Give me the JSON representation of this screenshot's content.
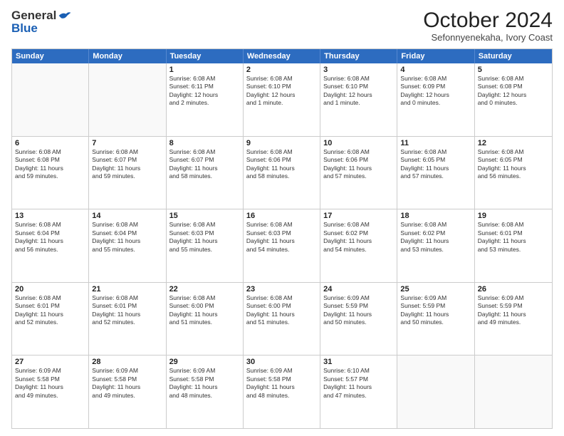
{
  "logo": {
    "general": "General",
    "blue": "Blue"
  },
  "title": "October 2024",
  "location": "Sefonnyenekaha, Ivory Coast",
  "header": {
    "days": [
      "Sunday",
      "Monday",
      "Tuesday",
      "Wednesday",
      "Thursday",
      "Friday",
      "Saturday"
    ]
  },
  "weeks": [
    [
      {
        "day": "",
        "info": ""
      },
      {
        "day": "",
        "info": ""
      },
      {
        "day": "1",
        "info": "Sunrise: 6:08 AM\nSunset: 6:11 PM\nDaylight: 12 hours\nand 2 minutes."
      },
      {
        "day": "2",
        "info": "Sunrise: 6:08 AM\nSunset: 6:10 PM\nDaylight: 12 hours\nand 1 minute."
      },
      {
        "day": "3",
        "info": "Sunrise: 6:08 AM\nSunset: 6:10 PM\nDaylight: 12 hours\nand 1 minute."
      },
      {
        "day": "4",
        "info": "Sunrise: 6:08 AM\nSunset: 6:09 PM\nDaylight: 12 hours\nand 0 minutes."
      },
      {
        "day": "5",
        "info": "Sunrise: 6:08 AM\nSunset: 6:08 PM\nDaylight: 12 hours\nand 0 minutes."
      }
    ],
    [
      {
        "day": "6",
        "info": "Sunrise: 6:08 AM\nSunset: 6:08 PM\nDaylight: 11 hours\nand 59 minutes."
      },
      {
        "day": "7",
        "info": "Sunrise: 6:08 AM\nSunset: 6:07 PM\nDaylight: 11 hours\nand 59 minutes."
      },
      {
        "day": "8",
        "info": "Sunrise: 6:08 AM\nSunset: 6:07 PM\nDaylight: 11 hours\nand 58 minutes."
      },
      {
        "day": "9",
        "info": "Sunrise: 6:08 AM\nSunset: 6:06 PM\nDaylight: 11 hours\nand 58 minutes."
      },
      {
        "day": "10",
        "info": "Sunrise: 6:08 AM\nSunset: 6:06 PM\nDaylight: 11 hours\nand 57 minutes."
      },
      {
        "day": "11",
        "info": "Sunrise: 6:08 AM\nSunset: 6:05 PM\nDaylight: 11 hours\nand 57 minutes."
      },
      {
        "day": "12",
        "info": "Sunrise: 6:08 AM\nSunset: 6:05 PM\nDaylight: 11 hours\nand 56 minutes."
      }
    ],
    [
      {
        "day": "13",
        "info": "Sunrise: 6:08 AM\nSunset: 6:04 PM\nDaylight: 11 hours\nand 56 minutes."
      },
      {
        "day": "14",
        "info": "Sunrise: 6:08 AM\nSunset: 6:04 PM\nDaylight: 11 hours\nand 55 minutes."
      },
      {
        "day": "15",
        "info": "Sunrise: 6:08 AM\nSunset: 6:03 PM\nDaylight: 11 hours\nand 55 minutes."
      },
      {
        "day": "16",
        "info": "Sunrise: 6:08 AM\nSunset: 6:03 PM\nDaylight: 11 hours\nand 54 minutes."
      },
      {
        "day": "17",
        "info": "Sunrise: 6:08 AM\nSunset: 6:02 PM\nDaylight: 11 hours\nand 54 minutes."
      },
      {
        "day": "18",
        "info": "Sunrise: 6:08 AM\nSunset: 6:02 PM\nDaylight: 11 hours\nand 53 minutes."
      },
      {
        "day": "19",
        "info": "Sunrise: 6:08 AM\nSunset: 6:01 PM\nDaylight: 11 hours\nand 53 minutes."
      }
    ],
    [
      {
        "day": "20",
        "info": "Sunrise: 6:08 AM\nSunset: 6:01 PM\nDaylight: 11 hours\nand 52 minutes."
      },
      {
        "day": "21",
        "info": "Sunrise: 6:08 AM\nSunset: 6:01 PM\nDaylight: 11 hours\nand 52 minutes."
      },
      {
        "day": "22",
        "info": "Sunrise: 6:08 AM\nSunset: 6:00 PM\nDaylight: 11 hours\nand 51 minutes."
      },
      {
        "day": "23",
        "info": "Sunrise: 6:08 AM\nSunset: 6:00 PM\nDaylight: 11 hours\nand 51 minutes."
      },
      {
        "day": "24",
        "info": "Sunrise: 6:09 AM\nSunset: 5:59 PM\nDaylight: 11 hours\nand 50 minutes."
      },
      {
        "day": "25",
        "info": "Sunrise: 6:09 AM\nSunset: 5:59 PM\nDaylight: 11 hours\nand 50 minutes."
      },
      {
        "day": "26",
        "info": "Sunrise: 6:09 AM\nSunset: 5:59 PM\nDaylight: 11 hours\nand 49 minutes."
      }
    ],
    [
      {
        "day": "27",
        "info": "Sunrise: 6:09 AM\nSunset: 5:58 PM\nDaylight: 11 hours\nand 49 minutes."
      },
      {
        "day": "28",
        "info": "Sunrise: 6:09 AM\nSunset: 5:58 PM\nDaylight: 11 hours\nand 49 minutes."
      },
      {
        "day": "29",
        "info": "Sunrise: 6:09 AM\nSunset: 5:58 PM\nDaylight: 11 hours\nand 48 minutes."
      },
      {
        "day": "30",
        "info": "Sunrise: 6:09 AM\nSunset: 5:58 PM\nDaylight: 11 hours\nand 48 minutes."
      },
      {
        "day": "31",
        "info": "Sunrise: 6:10 AM\nSunset: 5:57 PM\nDaylight: 11 hours\nand 47 minutes."
      },
      {
        "day": "",
        "info": ""
      },
      {
        "day": "",
        "info": ""
      }
    ]
  ]
}
